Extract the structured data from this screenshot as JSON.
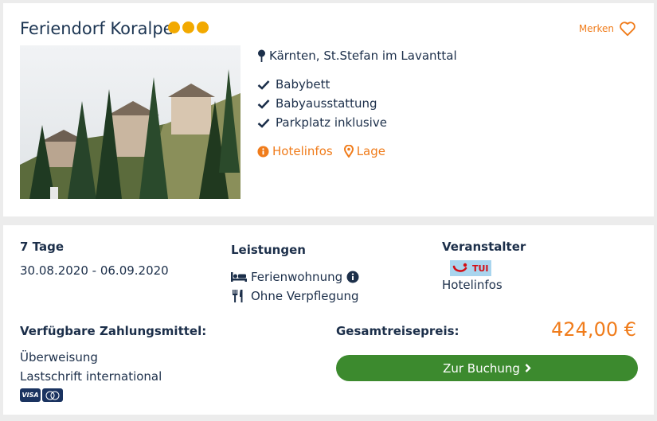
{
  "hotel": {
    "name": "Feriendorf Koralpe",
    "stars": 3,
    "merken_label": "Merken",
    "location": "Kärnten, St.Stefan im Lavanttal",
    "features": [
      "Babybett",
      "Babyausstattung",
      "Parkplatz inklusive"
    ],
    "hotelinfos_label": "Hotelinfos",
    "lage_label": "Lage"
  },
  "offer": {
    "duration": "7 Tage",
    "dates": "30.08.2020 - 06.09.2020",
    "services_heading": "Leistungen",
    "room": "Ferienwohnung",
    "board": "Ohne Verpflegung",
    "operator_heading": "Veranstalter",
    "operator_name": "TUI",
    "operator_link": "Hotelinfos",
    "payment_heading": "Verfügbare Zahlungsmittel:",
    "payment_methods": [
      "Überweisung",
      "Lastschrift international"
    ],
    "payment_badges": [
      "VISA",
      "Mastercard"
    ],
    "total_label": "Gesamtreisepreis:",
    "price": "424,00 €",
    "book_label": "Zur Buchung"
  },
  "colors": {
    "accent": "#f07c1b",
    "star": "#f2a900",
    "button": "#3c8a2e",
    "text": "#1c2f4a"
  }
}
